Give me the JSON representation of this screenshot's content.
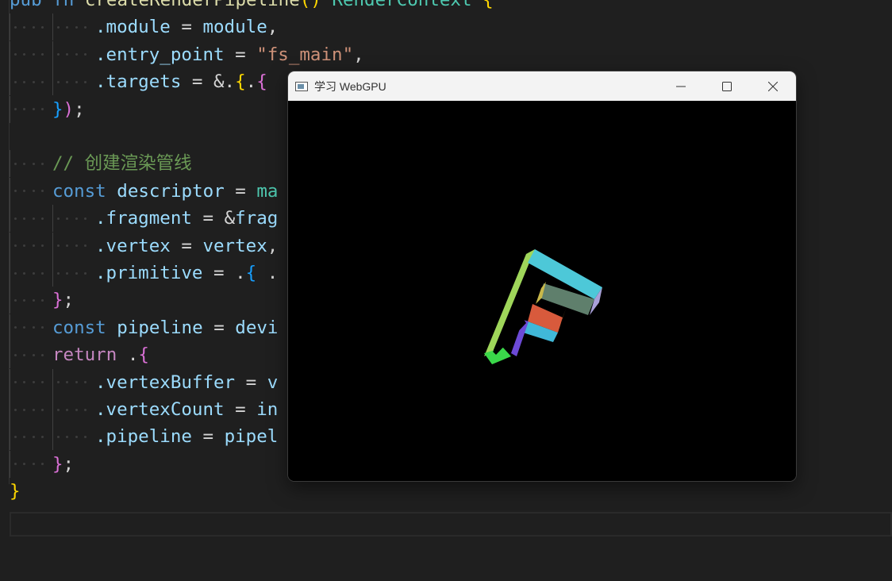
{
  "editor": {
    "lines": [
      {
        "indent": 0,
        "tokens": [
          {
            "t": "pub ",
            "c": "kw"
          },
          {
            "t": "fn ",
            "c": "kw"
          },
          {
            "t": "createRenderPipeline",
            "c": "fn"
          },
          {
            "t": "() ",
            "c": "b1"
          },
          {
            "t": "RenderContext ",
            "c": "type"
          },
          {
            "t": "{",
            "c": "b1"
          }
        ]
      },
      {
        "indent": 2,
        "tokens": [
          {
            "t": ".module",
            "c": "prop"
          },
          {
            "t": " = ",
            "c": "punc"
          },
          {
            "t": "module",
            "c": "prop"
          },
          {
            "t": ",",
            "c": "punc"
          }
        ]
      },
      {
        "indent": 2,
        "tokens": [
          {
            "t": ".entry_point",
            "c": "prop"
          },
          {
            "t": " = ",
            "c": "punc"
          },
          {
            "t": "\"fs_main\"",
            "c": "str"
          },
          {
            "t": ",",
            "c": "punc"
          }
        ]
      },
      {
        "indent": 2,
        "tokens": [
          {
            "t": ".targets",
            "c": "prop"
          },
          {
            "t": " = ",
            "c": "punc"
          },
          {
            "t": "&.",
            "c": "punc"
          },
          {
            "t": "{",
            "c": "b1"
          },
          {
            "t": ".",
            "c": "punc"
          },
          {
            "t": "{",
            "c": "b2"
          }
        ]
      },
      {
        "indent": 1,
        "tokens": [
          {
            "t": "}",
            "c": "b3"
          },
          {
            "t": ")",
            "c": "b2"
          },
          {
            "t": ";",
            "c": "punc"
          }
        ]
      },
      {
        "indent": 0,
        "tokens": []
      },
      {
        "indent": 1,
        "tokens": [
          {
            "t": "// 创建渲染管线",
            "c": "cmt"
          }
        ]
      },
      {
        "indent": 1,
        "tokens": [
          {
            "t": "const ",
            "c": "kw"
          },
          {
            "t": "descriptor",
            "c": "prop"
          },
          {
            "t": " = ",
            "c": "punc"
          },
          {
            "t": "ma",
            "c": "type"
          }
        ]
      },
      {
        "indent": 2,
        "tokens": [
          {
            "t": ".fragment",
            "c": "prop"
          },
          {
            "t": " = ",
            "c": "punc"
          },
          {
            "t": "&",
            "c": "punc"
          },
          {
            "t": "frag",
            "c": "prop"
          }
        ]
      },
      {
        "indent": 2,
        "tokens": [
          {
            "t": ".vertex",
            "c": "prop"
          },
          {
            "t": " = ",
            "c": "punc"
          },
          {
            "t": "vertex",
            "c": "prop"
          },
          {
            "t": ",",
            "c": "punc"
          }
        ]
      },
      {
        "indent": 2,
        "tokens": [
          {
            "t": ".primitive",
            "c": "prop"
          },
          {
            "t": " = ",
            "c": "punc"
          },
          {
            "t": ".",
            "c": "punc"
          },
          {
            "t": "{",
            "c": "b3"
          },
          {
            "t": " .",
            "c": "punc"
          }
        ]
      },
      {
        "indent": 1,
        "tokens": [
          {
            "t": "}",
            "c": "b2"
          },
          {
            "t": ";",
            "c": "punc"
          }
        ]
      },
      {
        "indent": 1,
        "tokens": [
          {
            "t": "const ",
            "c": "kw"
          },
          {
            "t": "pipeline",
            "c": "prop"
          },
          {
            "t": " = ",
            "c": "punc"
          },
          {
            "t": "devi",
            "c": "prop"
          }
        ]
      },
      {
        "indent": 1,
        "tokens": [
          {
            "t": "return ",
            "c": "kw2"
          },
          {
            "t": ".",
            "c": "punc"
          },
          {
            "t": "{",
            "c": "b2"
          }
        ]
      },
      {
        "indent": 2,
        "tokens": [
          {
            "t": ".vertexBuffer",
            "c": "prop"
          },
          {
            "t": " = ",
            "c": "punc"
          },
          {
            "t": "v",
            "c": "prop"
          }
        ]
      },
      {
        "indent": 2,
        "tokens": [
          {
            "t": ".vertexCount",
            "c": "prop"
          },
          {
            "t": " = ",
            "c": "punc"
          },
          {
            "t": "in",
            "c": "prop"
          }
        ]
      },
      {
        "indent": 2,
        "tokens": [
          {
            "t": ".pipeline",
            "c": "prop"
          },
          {
            "t": " = ",
            "c": "punc"
          },
          {
            "t": "pipel",
            "c": "prop"
          }
        ]
      },
      {
        "indent": 1,
        "tokens": [
          {
            "t": "}",
            "c": "b2"
          },
          {
            "t": ";",
            "c": "punc"
          }
        ]
      },
      {
        "indent": 0,
        "tokens": [
          {
            "t": "}",
            "c": "b1"
          }
        ]
      }
    ]
  },
  "window": {
    "title": "学习 WebGPU",
    "controls": {
      "minimize": "minimize-icon",
      "maximize": "maximize-icon",
      "close": "close-icon"
    },
    "scene": "3D rotated letter F with multicolored faces"
  },
  "colors": {
    "editor_bg": "#1f1f1f",
    "titlebar_bg": "#f3f3f3",
    "canvas_bg": "#000000"
  }
}
